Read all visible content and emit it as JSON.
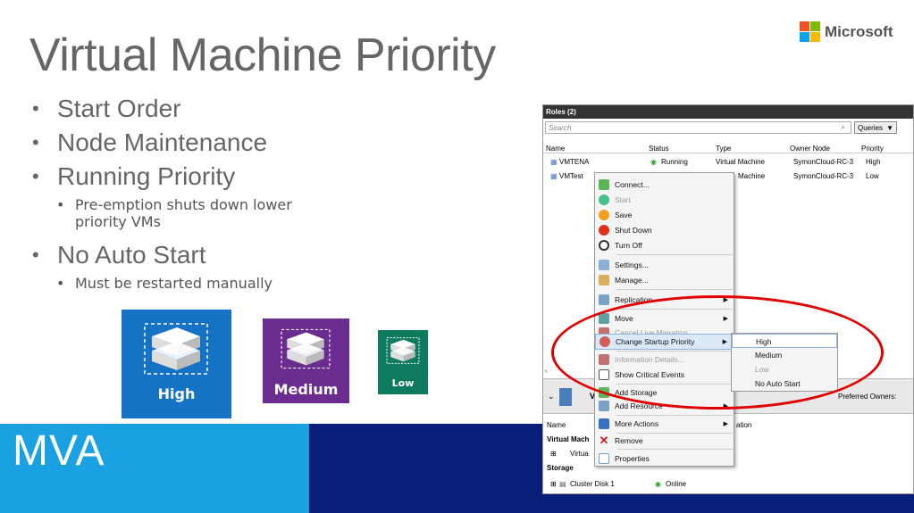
{
  "slide": {
    "title": "Virtual Machine Priority",
    "logo_text": "Microsoft",
    "banner_text": "MVA",
    "bullets": [
      {
        "text": "Start Order",
        "sub": []
      },
      {
        "text": "Node Maintenance",
        "sub": []
      },
      {
        "text": "Running Priority",
        "sub": [
          "Pre-emption shuts down lower priority VMs"
        ]
      },
      {
        "text": "No Auto Start",
        "sub": [
          "Must be restarted manually"
        ]
      }
    ],
    "tiles": [
      {
        "label": "High",
        "color": "#1672c4"
      },
      {
        "label": "Medium",
        "color": "#6b2c8f"
      },
      {
        "label": "Low",
        "color": "#0e7a5e"
      }
    ]
  },
  "window": {
    "header": "Roles (2)",
    "search_placeholder": "Search",
    "queries_label": "Queries",
    "columns": [
      "Name",
      "Status",
      "Type",
      "Owner Node",
      "Priority"
    ],
    "rows": [
      {
        "name": "VMTENA",
        "status": "Running",
        "type": "Virtual Machine",
        "owner": "SymonCloud-RC-3",
        "priority": "High"
      },
      {
        "name": "VMTest",
        "status": "",
        "type": "Machine",
        "owner": "SymonCloud-RC-3",
        "priority": "Low"
      }
    ],
    "preferred_owners": "Preferred Owners:",
    "bottom": {
      "name_col": "Name",
      "info_col": "ation",
      "group_vm": "Virtual Mach",
      "vm_item": "Virtua",
      "group_storage": "Storage",
      "disk": "Cluster Disk 1",
      "disk_status": "Online",
      "v_label": "V"
    }
  },
  "context_menu": [
    {
      "label": "Connect...",
      "disabled": false,
      "submenu": false
    },
    {
      "label": "Start",
      "disabled": true,
      "submenu": false
    },
    {
      "label": "Save",
      "disabled": false,
      "submenu": false
    },
    {
      "label": "Shut Down",
      "disabled": false,
      "submenu": false
    },
    {
      "label": "Turn Off",
      "disabled": false,
      "submenu": false
    },
    {
      "label": "Settings...",
      "disabled": false,
      "submenu": false
    },
    {
      "label": "Manage...",
      "disabled": false,
      "submenu": false
    },
    {
      "label": "Replication",
      "disabled": false,
      "submenu": true
    },
    {
      "label": "Move",
      "disabled": false,
      "submenu": true
    },
    {
      "label": "Cancel Live Migration",
      "disabled": true,
      "submenu": false
    },
    {
      "label": "Change Startup Priority",
      "disabled": false,
      "submenu": true
    },
    {
      "label": "Information Details...",
      "disabled": true,
      "submenu": false
    },
    {
      "label": "Show Critical Events",
      "disabled": false,
      "submenu": false
    },
    {
      "label": "Add Storage",
      "disabled": false,
      "submenu": false
    },
    {
      "label": "Add Resource",
      "disabled": false,
      "submenu": true
    },
    {
      "label": "More Actions",
      "disabled": false,
      "submenu": true
    },
    {
      "label": "Remove",
      "disabled": false,
      "submenu": false
    },
    {
      "label": "Properties",
      "disabled": false,
      "submenu": false
    }
  ],
  "priority_submenu": [
    {
      "label": "High",
      "disabled": false
    },
    {
      "label": "Medium",
      "disabled": false
    },
    {
      "label": "Low",
      "disabled": true
    },
    {
      "label": "No Auto Start",
      "disabled": false
    }
  ],
  "colors": {
    "highlight_ellipse": "#e00000",
    "banner_light": "#1aa1e1",
    "banner_dark": "#0a1f7a"
  }
}
